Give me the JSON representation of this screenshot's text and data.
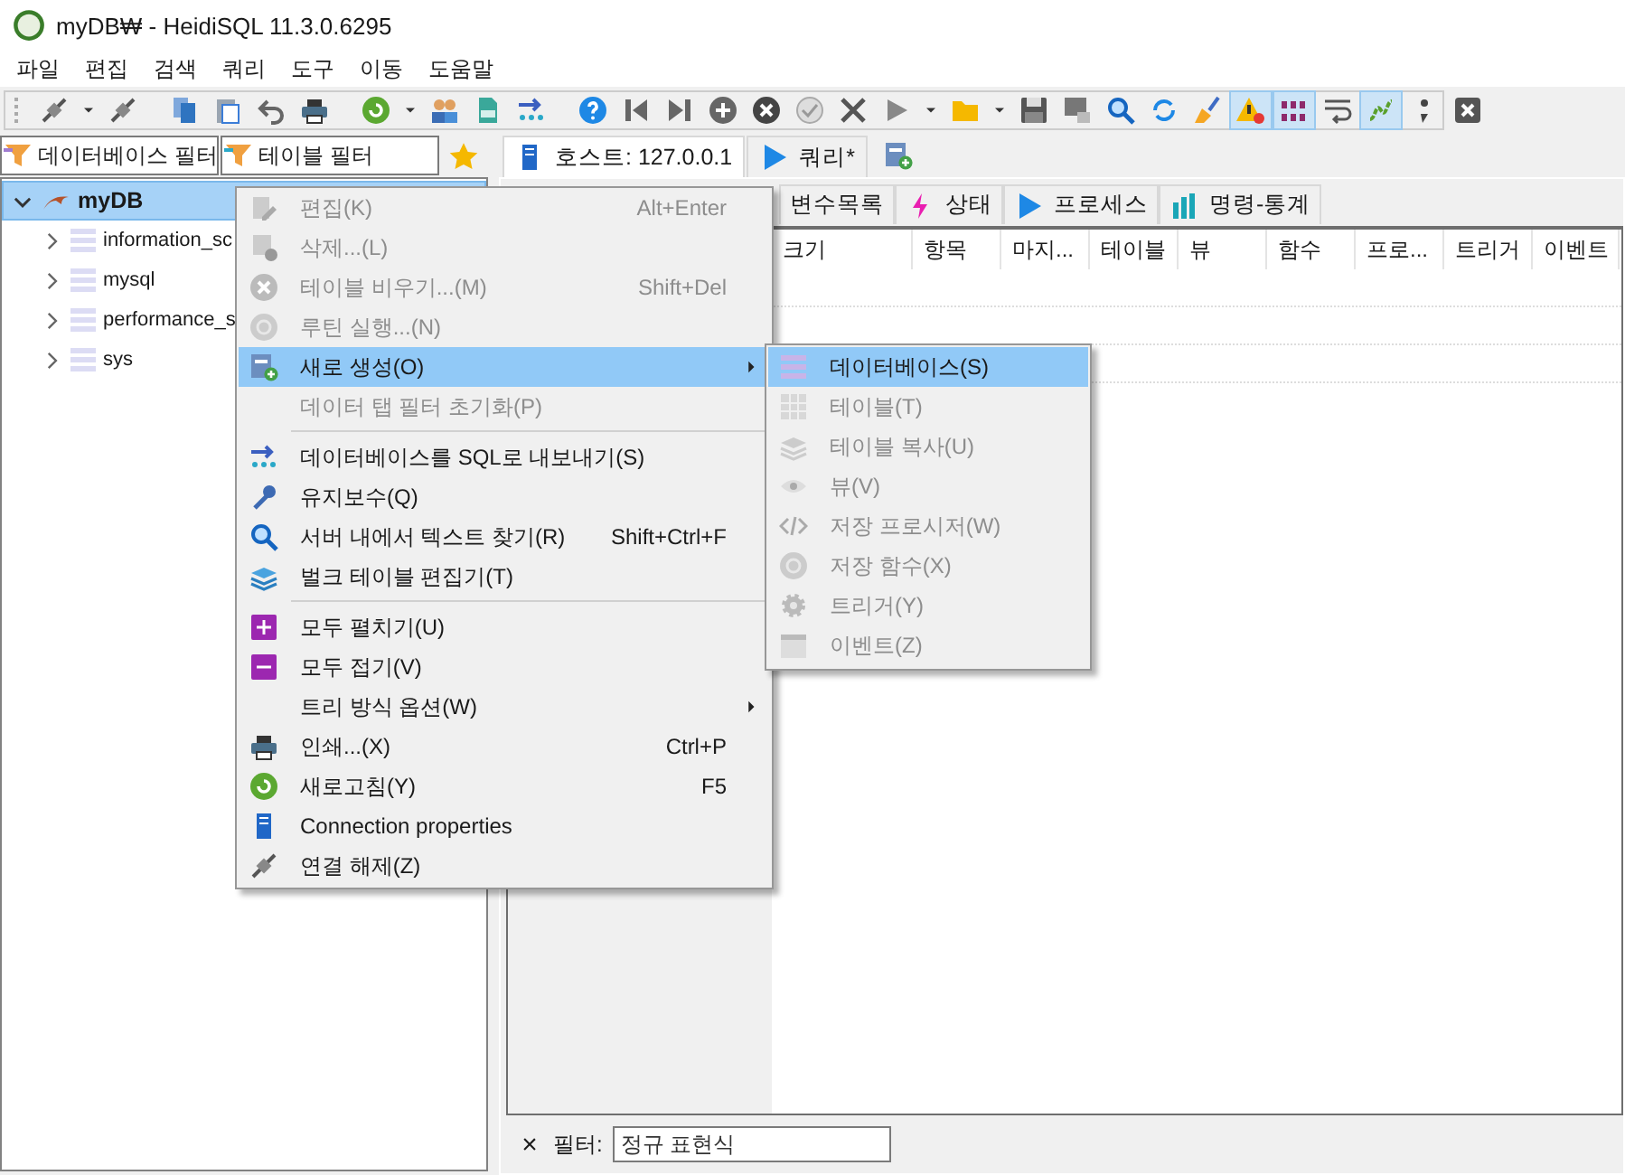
{
  "window": {
    "title": "myDB₩ - HeidiSQL 11.3.0.6295"
  },
  "menu_bar": [
    "파일",
    "편집",
    "검색",
    "쿼리",
    "도구",
    "이동",
    "도움말"
  ],
  "toolbar": [
    {
      "kind": "button",
      "pressed": false
    },
    {
      "kind": "dropdown"
    },
    {
      "kind": "button",
      "pressed": false
    },
    {
      "kind": "separator"
    },
    {
      "kind": "button",
      "pressed": false
    },
    {
      "kind": "button",
      "pressed": false
    },
    {
      "kind": "button",
      "pressed": false
    },
    {
      "kind": "button",
      "pressed": false
    },
    {
      "kind": "separator"
    },
    {
      "kind": "button",
      "pressed": false
    },
    {
      "kind": "dropdown"
    },
    {
      "kind": "button",
      "pressed": false
    },
    {
      "kind": "button",
      "pressed": false
    },
    {
      "kind": "button",
      "pressed": false
    },
    {
      "kind": "separator"
    },
    {
      "kind": "button",
      "pressed": false
    },
    {
      "kind": "button",
      "pressed": false
    },
    {
      "kind": "button",
      "pressed": false
    },
    {
      "kind": "button",
      "pressed": false
    },
    {
      "kind": "button",
      "pressed": false
    },
    {
      "kind": "button",
      "pressed": false
    },
    {
      "kind": "button",
      "pressed": false
    },
    {
      "kind": "button",
      "pressed": false
    },
    {
      "kind": "dropdown"
    },
    {
      "kind": "button",
      "pressed": false
    },
    {
      "kind": "dropdown"
    },
    {
      "kind": "button",
      "pressed": false
    },
    {
      "kind": "button",
      "pressed": false
    },
    {
      "kind": "button",
      "pressed": false
    },
    {
      "kind": "button",
      "pressed": false
    },
    {
      "kind": "button",
      "pressed": false
    },
    {
      "kind": "button",
      "pressed": true
    },
    {
      "kind": "button",
      "pressed": true
    },
    {
      "kind": "button",
      "pressed": false
    },
    {
      "kind": "button",
      "pressed": true
    },
    {
      "kind": "button",
      "pressed": false
    },
    {
      "kind": "button",
      "pressed": false
    }
  ],
  "filters": {
    "database": {
      "placeholder": "데이터베이스 필터"
    },
    "table": {
      "placeholder": "테이블 필터"
    }
  },
  "tree": [
    {
      "label": "myDB",
      "expanded": true,
      "selected": true,
      "children": [
        {
          "label": "information_sc",
          "expanded": false,
          "selected": false
        },
        {
          "label": "mysql",
          "expanded": false,
          "selected": false
        },
        {
          "label": "performance_s",
          "expanded": false,
          "selected": false
        },
        {
          "label": "sys",
          "expanded": false,
          "selected": false
        }
      ]
    }
  ],
  "tabs": [
    {
      "label": "호스트: 127.0.0.1",
      "selected": true
    },
    {
      "label": "쿼리*",
      "selected": false
    }
  ],
  "sub_tabs": [
    {
      "label": "변수목록",
      "selected": false
    },
    {
      "label": "상태",
      "selected": false
    },
    {
      "label": "프로세스",
      "selected": false
    },
    {
      "label": "명령-통계",
      "selected": false
    }
  ],
  "grid": {
    "columns": [
      "크기",
      "항목",
      "마지...",
      "테이블",
      "뷰",
      "함수",
      "프로...",
      "트리거",
      "이벤트"
    ]
  },
  "filter_bar": {
    "close": "×",
    "label": "필터:",
    "placeholder": "정규 표현식"
  },
  "context_menu": {
    "groups": [
      [
        {
          "label": "편집(K)",
          "shortcut": "Alt+Enter",
          "disabled": true,
          "selected": false,
          "submenu": false
        },
        {
          "label": "삭제...(L)",
          "disabled": true,
          "selected": false,
          "submenu": false
        },
        {
          "label": "테이블 비우기...(M)",
          "shortcut": "Shift+Del",
          "disabled": true,
          "selected": false,
          "submenu": false
        },
        {
          "label": "루틴 실행...(N)",
          "disabled": true,
          "selected": false,
          "submenu": false
        },
        {
          "label": "새로 생성(O)",
          "disabled": false,
          "selected": true,
          "submenu": true
        },
        {
          "label": "데이터 탭 필터 초기화(P)",
          "disabled": true,
          "selected": false,
          "submenu": false
        }
      ],
      [
        {
          "label": "데이터베이스를 SQL로 내보내기(S)",
          "disabled": false,
          "selected": false,
          "submenu": false
        },
        {
          "label": "유지보수(Q)",
          "disabled": false,
          "selected": false,
          "submenu": false
        },
        {
          "label": "서버 내에서 텍스트 찾기(R)",
          "shortcut": "Shift+Ctrl+F",
          "disabled": false,
          "selected": false,
          "submenu": false
        },
        {
          "label": "벌크 테이블 편집기(T)",
          "disabled": false,
          "selected": false,
          "submenu": false
        }
      ],
      [
        {
          "label": "모두 펼치기(U)",
          "disabled": false,
          "selected": false,
          "submenu": false
        },
        {
          "label": "모두 접기(V)",
          "disabled": false,
          "selected": false,
          "submenu": false
        },
        {
          "label": "트리 방식 옵션(W)",
          "disabled": false,
          "selected": false,
          "submenu": true
        },
        {
          "label": "인쇄...(X)",
          "shortcut": "Ctrl+P",
          "disabled": false,
          "selected": false,
          "submenu": false
        },
        {
          "label": "새로고침(Y)",
          "shortcut": "F5",
          "disabled": false,
          "selected": false,
          "submenu": false
        },
        {
          "label": "Connection properties",
          "disabled": false,
          "selected": false,
          "submenu": false
        },
        {
          "label": "연결 해제(Z)",
          "disabled": false,
          "selected": false,
          "submenu": false
        }
      ]
    ]
  },
  "submenu": {
    "items": [
      {
        "label": "데이터베이스(S)",
        "disabled": false,
        "selected": true
      },
      {
        "label": "테이블(T)",
        "disabled": true,
        "selected": false
      },
      {
        "label": "테이블 복사(U)",
        "disabled": true,
        "selected": false
      },
      {
        "label": "뷰(V)",
        "disabled": true,
        "selected": false
      },
      {
        "label": "저장 프로시저(W)",
        "disabled": true,
        "selected": false
      },
      {
        "label": "저장 함수(X)",
        "disabled": true,
        "selected": false
      },
      {
        "label": "트리거(Y)",
        "disabled": true,
        "selected": false
      },
      {
        "label": "이벤트(Z)",
        "disabled": true,
        "selected": false
      }
    ]
  }
}
